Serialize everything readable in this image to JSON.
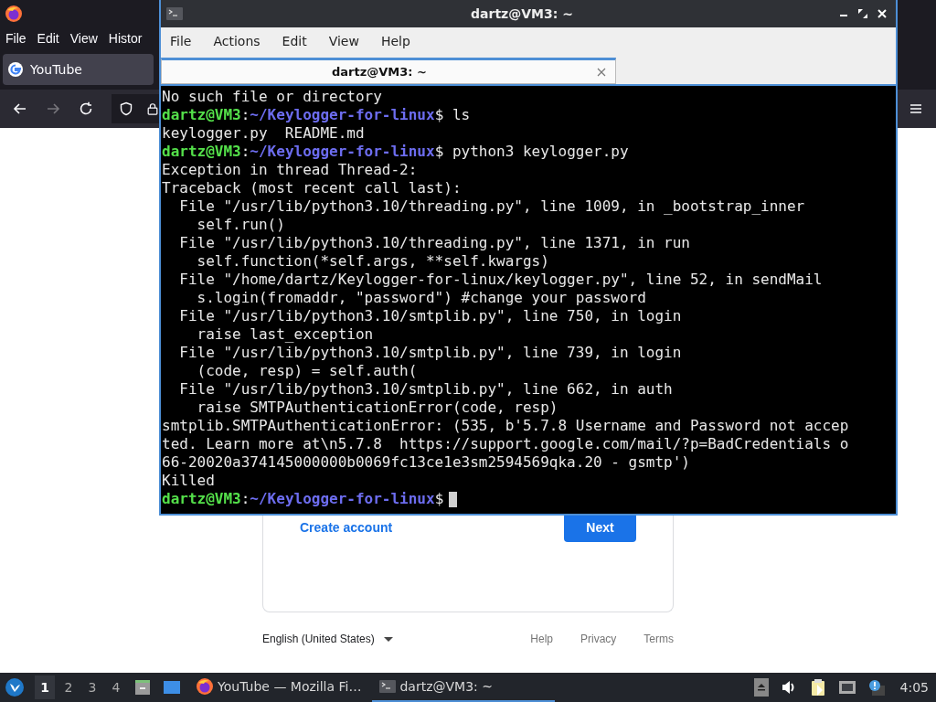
{
  "browser": {
    "menu": [
      "File",
      "Edit",
      "View",
      "Histor"
    ],
    "tabs": [
      {
        "title": "YouTube",
        "selected": true
      }
    ],
    "page": {
      "create_account": "Create account",
      "next": "Next",
      "language": "English (United States)",
      "footer_links": [
        "Help",
        "Privacy",
        "Terms"
      ]
    }
  },
  "terminal": {
    "title": "dartz@VM3: ~",
    "menu": [
      "File",
      "Actions",
      "Edit",
      "View",
      "Help"
    ],
    "tabs": [
      {
        "title": "dartz@VM3: ~",
        "selected": true
      }
    ],
    "lines": [
      {
        "kind": "output",
        "text": "No such file or directory"
      },
      {
        "kind": "prompt",
        "user": "dartz@VM3",
        "separator": ":",
        "path": "~/Keylogger-for-linux",
        "symbol": "$",
        "command": "ls"
      },
      {
        "kind": "output",
        "text": "keylogger.py  README.md"
      },
      {
        "kind": "prompt",
        "user": "dartz@VM3",
        "separator": ":",
        "path": "~/Keylogger-for-linux",
        "symbol": "$",
        "command": "python3 keylogger.py"
      },
      {
        "kind": "output",
        "text": "Exception in thread Thread-2:"
      },
      {
        "kind": "output",
        "text": "Traceback (most recent call last):"
      },
      {
        "kind": "output",
        "text": "  File \"/usr/lib/python3.10/threading.py\", line 1009, in _bootstrap_inner"
      },
      {
        "kind": "output",
        "text": "    self.run()"
      },
      {
        "kind": "output",
        "text": "  File \"/usr/lib/python3.10/threading.py\", line 1371, in run"
      },
      {
        "kind": "output",
        "text": "    self.function(*self.args, **self.kwargs)"
      },
      {
        "kind": "output",
        "text": "  File \"/home/dartz/Keylogger-for-linux/keylogger.py\", line 52, in sendMail"
      },
      {
        "kind": "output",
        "text": "    s.login(fromaddr, \"password\") #change your password"
      },
      {
        "kind": "output",
        "text": "  File \"/usr/lib/python3.10/smtplib.py\", line 750, in login"
      },
      {
        "kind": "output",
        "text": "    raise last_exception"
      },
      {
        "kind": "output",
        "text": "  File \"/usr/lib/python3.10/smtplib.py\", line 739, in login"
      },
      {
        "kind": "output",
        "text": "    (code, resp) = self.auth("
      },
      {
        "kind": "output",
        "text": "  File \"/usr/lib/python3.10/smtplib.py\", line 662, in auth"
      },
      {
        "kind": "output",
        "text": "    raise SMTPAuthenticationError(code, resp)"
      },
      {
        "kind": "output",
        "text": "smtplib.SMTPAuthenticationError: (535, b'5.7.8 Username and Password not accep"
      },
      {
        "kind": "output",
        "text": "ted. Learn more at\\n5.7.8  https://support.google.com/mail/?p=BadCredentials o"
      },
      {
        "kind": "output",
        "text": "66-20020a374145000000b0069fc13ce1e3sm2594569qka.20 - gsmtp')"
      },
      {
        "kind": "output",
        "text": "Killed"
      },
      {
        "kind": "prompt",
        "user": "dartz@VM3",
        "separator": ":",
        "path": "~/Keylogger-for-linux",
        "symbol": "$",
        "cursor": true
      }
    ]
  },
  "taskbar": {
    "workspaces": [
      {
        "label": "1",
        "selected": true
      },
      {
        "label": "2",
        "selected": false
      },
      {
        "label": "3",
        "selected": false
      },
      {
        "label": "4",
        "selected": false
      }
    ],
    "tasks": [
      {
        "kind": "browser",
        "title": "YouTube — Mozilla Fi…",
        "selected": false
      },
      {
        "kind": "terminal",
        "title": "dartz@VM3: ~",
        "selected": true
      }
    ],
    "clock": "4:05"
  }
}
